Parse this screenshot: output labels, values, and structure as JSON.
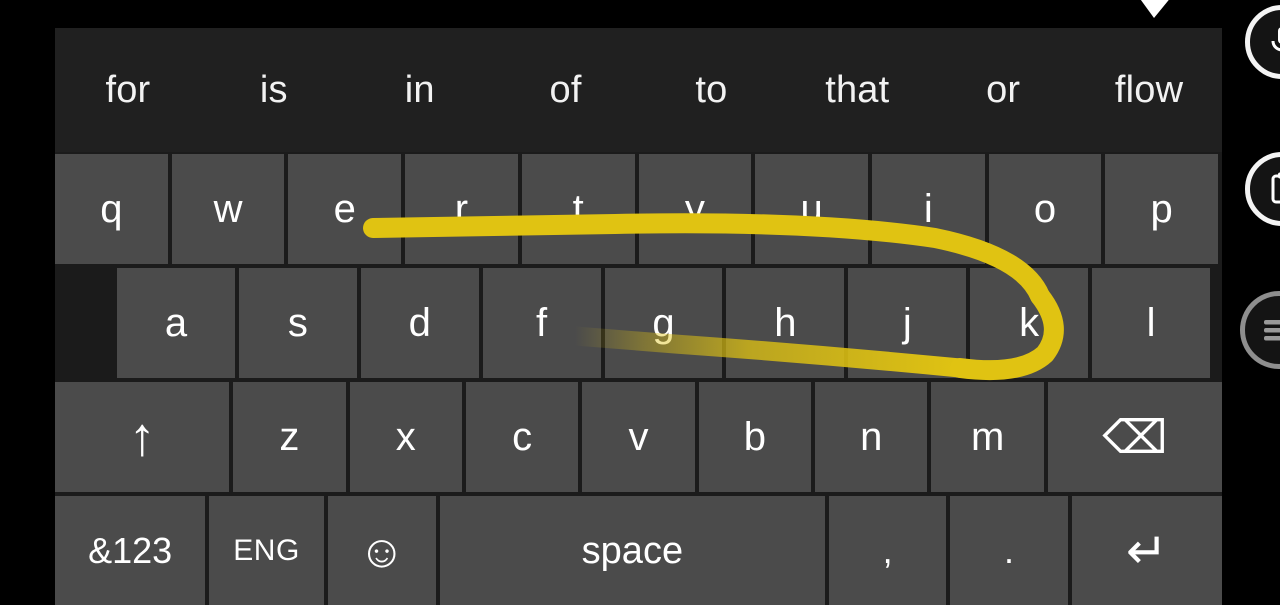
{
  "window": {
    "background_color": "#000000",
    "keyboard_background": "#1b1b1b",
    "suggestion_bar_color": "#202020",
    "key_color": "#4b4b4b",
    "key_text_color": "#ffffff",
    "swipe_trail_color": "#e0c312"
  },
  "suggestions": {
    "items": [
      {
        "label": "for"
      },
      {
        "label": "is"
      },
      {
        "label": "in"
      },
      {
        "label": "of"
      },
      {
        "label": "to"
      },
      {
        "label": "that"
      },
      {
        "label": "or"
      },
      {
        "label": "flow"
      }
    ]
  },
  "keyboard": {
    "row1": [
      {
        "label": "q"
      },
      {
        "label": "w"
      },
      {
        "label": "e"
      },
      {
        "label": "r"
      },
      {
        "label": "t"
      },
      {
        "label": "y"
      },
      {
        "label": "u"
      },
      {
        "label": "i"
      },
      {
        "label": "o"
      },
      {
        "label": "p"
      }
    ],
    "row2": [
      {
        "label": "a"
      },
      {
        "label": "s"
      },
      {
        "label": "d"
      },
      {
        "label": "f"
      },
      {
        "label": "g"
      },
      {
        "label": "h"
      },
      {
        "label": "j"
      },
      {
        "label": "k"
      },
      {
        "label": "l"
      }
    ],
    "row3": {
      "shift": {
        "label": "↑",
        "icon": "arrow-up-icon"
      },
      "letters": [
        {
          "label": "z"
        },
        {
          "label": "x"
        },
        {
          "label": "c"
        },
        {
          "label": "v"
        },
        {
          "label": "b"
        },
        {
          "label": "n"
        },
        {
          "label": "m"
        }
      ],
      "backspace": {
        "label": "⌫",
        "icon": "backspace-icon"
      }
    },
    "row4": {
      "symbols": {
        "label": "&123"
      },
      "language": {
        "label": "ENG"
      },
      "emoji": {
        "label": "☺",
        "icon": "smiley-icon"
      },
      "space": {
        "label": "space"
      },
      "comma": {
        "label": ","
      },
      "period": {
        "label": "."
      },
      "enter": {
        "label": "↵",
        "icon": "enter-icon"
      }
    }
  },
  "edge_buttons": [
    {
      "name": "microphone-button",
      "icon": "microphone-icon"
    },
    {
      "name": "clipboard-button",
      "icon": "clipboard-icon"
    },
    {
      "name": "menu-button",
      "icon": "menu-list-icon"
    }
  ],
  "swipe_gesture": {
    "trail_color": "#e0c312",
    "traced_keys": [
      "e",
      "r",
      "t",
      "y",
      "u",
      "i",
      "k",
      "j",
      "h",
      "g"
    ]
  }
}
